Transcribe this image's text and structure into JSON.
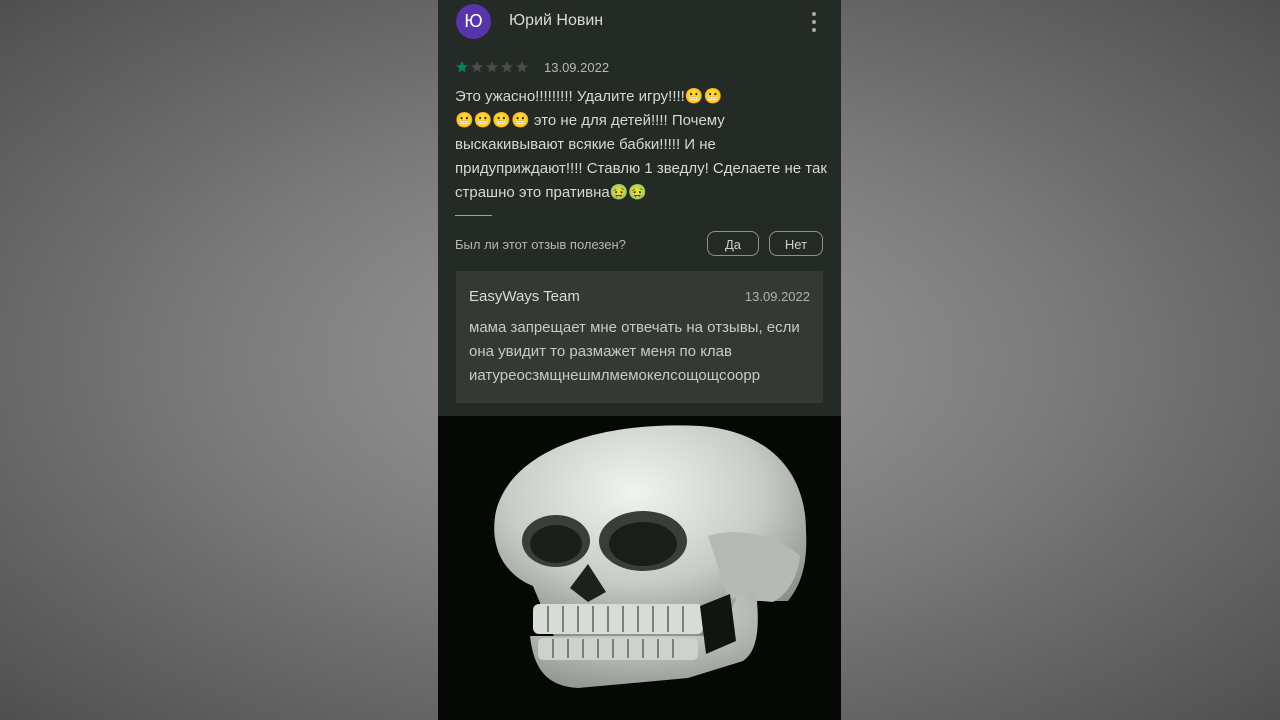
{
  "review": {
    "avatar_letter": "Ю",
    "author": "Юрий Новин",
    "rating": 1,
    "rating_max": 5,
    "date": "13.09.2022",
    "text": "Это ужасно!!!!!!!!! Удалите игру!!!!😬😬\n😬😬😬😬 это не для детей!!!! Почему выскакивывают всякие бабки!!!!! И не придуприждают!!!! Ставлю 1 зведлу! Сделаете не так страшно это пративна🤢🤢",
    "helpful_question": "Был ли этот отзыв полезен?",
    "yes_label": "Да",
    "no_label": "Нет"
  },
  "developer_reply": {
    "name": "EasyWays Team",
    "date": "13.09.2022",
    "text": "мама запрещает мне отвечать на отзывы, если она увидит то размажет меня по клав иатуреосзмщнешмлмемокелсощощсоорр"
  },
  "colors": {
    "star_filled": "#01875f",
    "star_empty": "#4a4e49",
    "avatar": "#5535a8"
  },
  "icons": {
    "menu": "more-vert-icon",
    "star": "star-icon",
    "image": "skull-image"
  }
}
